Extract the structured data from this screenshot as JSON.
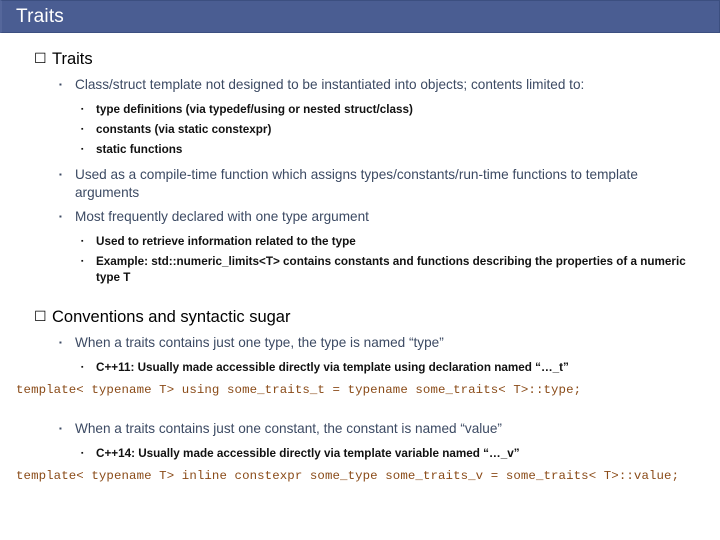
{
  "slide": {
    "title": "Traits",
    "markers": {
      "level1": "☐",
      "level2": "▪",
      "level3": "▪"
    },
    "colors": {
      "title_bar_bg": "#4a5d92",
      "title_bar_border": "#3c4f80",
      "title_text": "#ffffff",
      "level1_text": "#000000",
      "level2_text": "#3c4a63",
      "level3_text": "#111111",
      "code_text": "#8a4b18",
      "background": "#ffffff"
    },
    "sections": [
      {
        "heading": "Traits",
        "bullets": [
          {
            "level": 2,
            "text": "Class/struct template not designed to be instantiated into objects; contents limited to:"
          },
          {
            "level": 3,
            "text": "type definitions (via typedef/using or nested struct/class)"
          },
          {
            "level": 3,
            "text": "constants (via static constexpr)"
          },
          {
            "level": 3,
            "text": "static functions"
          },
          {
            "level": 2,
            "text": "Used as a compile-time function which assigns types/constants/run-time functions to template arguments"
          },
          {
            "level": 2,
            "text": "Most frequently declared with one type argument"
          },
          {
            "level": 3,
            "text": "Used to retrieve information related to the type"
          },
          {
            "level": 3,
            "text": "Example: std::numeric_limits<T> contains constants and functions describing the properties of a numeric type T"
          }
        ]
      },
      {
        "heading": "Conventions and syntactic sugar",
        "bullets": [
          {
            "level": 2,
            "text": "When a traits contains just one type, the type is named “type”"
          },
          {
            "level": 3,
            "text": "C++11: Usually made accessible directly via template using declaration named “…_t”"
          },
          {
            "level": "code",
            "text": "template< typename T> using some_traits_t = typename some_traits< T>::type;"
          },
          {
            "level": 2,
            "text": "When a traits contains just one constant, the constant is named “value”"
          },
          {
            "level": 3,
            "text": "C++14: Usually made accessible directly via template variable named “…_v”"
          },
          {
            "level": "code",
            "text": "template< typename T> inline constexpr some_type some_traits_v = some_traits< T>::value;"
          }
        ]
      }
    ]
  }
}
